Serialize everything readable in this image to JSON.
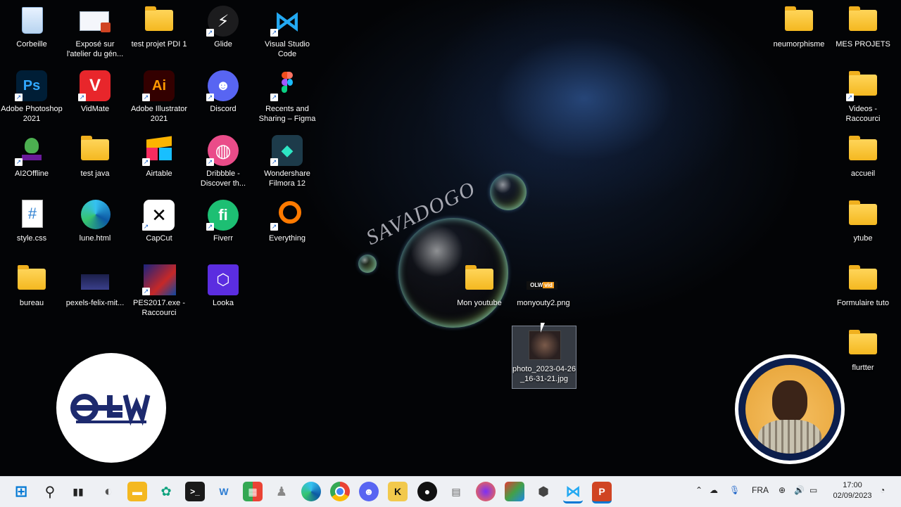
{
  "desktop_icons": [
    {
      "label": "Corbeille",
      "icon": "recycle-bin-icon"
    },
    {
      "label": "Exposé sur l'atelier du gén...",
      "icon": "powerpoint-file-icon"
    },
    {
      "label": "test projet PDI 1",
      "icon": "folder-icon"
    },
    {
      "label": "Glide",
      "icon": "glide-icon"
    },
    {
      "label": "Visual Studio Code",
      "icon": "vscode-icon"
    },
    {
      "label": "Adobe Photoshop 2021",
      "icon": "photoshop-icon"
    },
    {
      "label": "VidMate",
      "icon": "vidmate-icon"
    },
    {
      "label": "Adobe Illustrator 2021",
      "icon": "illustrator-icon"
    },
    {
      "label": "Discord",
      "icon": "discord-icon"
    },
    {
      "label": "Recents and Sharing – Figma",
      "icon": "figma-icon"
    },
    {
      "label": "AI2Offline",
      "icon": "ai2offline-icon"
    },
    {
      "label": "test java",
      "icon": "folder-icon"
    },
    {
      "label": "Airtable",
      "icon": "airtable-icon"
    },
    {
      "label": "Dribbble - Discover th...",
      "icon": "dribbble-icon"
    },
    {
      "label": "Wondershare Filmora 12",
      "icon": "filmora-icon"
    },
    {
      "label": "style.css",
      "icon": "css-file-icon"
    },
    {
      "label": "lune.html",
      "icon": "edge-html-icon"
    },
    {
      "label": "CapCut",
      "icon": "capcut-icon"
    },
    {
      "label": "Fiverr",
      "icon": "fiverr-icon"
    },
    {
      "label": "Everything",
      "icon": "everything-icon"
    },
    {
      "label": "bureau",
      "icon": "folder-icon"
    },
    {
      "label": "pexels-felix-mit...",
      "icon": "image-file-icon"
    },
    {
      "label": "PES2017.exe - Raccourci",
      "icon": "pes2017-icon"
    },
    {
      "label": "Looka",
      "icon": "looka-icon"
    },
    {
      "label": "Mon youtube",
      "icon": "folder-icon"
    },
    {
      "label": "monyouty2.png",
      "icon": "image-file-icon"
    },
    {
      "label": "photo_2023-04-26_16-31-21.jpg",
      "icon": "image-file-icon"
    },
    {
      "label": "neumorphisme",
      "icon": "folder-icon"
    },
    {
      "label": "MES PROJETS",
      "icon": "folder-icon"
    },
    {
      "label": "Videos - Raccourci",
      "icon": "folder-icon"
    },
    {
      "label": "accueil",
      "icon": "folder-icon"
    },
    {
      "label": "ytube",
      "icon": "folder-icon"
    },
    {
      "label": "Formulaire tuto",
      "icon": "folder-icon"
    },
    {
      "label": "flurtter",
      "icon": "folder-icon"
    }
  ],
  "glyphs": {
    "ps": "Ps",
    "vm": "V",
    "ai": "Ai",
    "hash": "#",
    "k": "K",
    "olw": "OLW",
    "vid": "vid"
  },
  "watermark": "SAVADOGO",
  "taskbar": {
    "language": "FRA",
    "time": "17:00",
    "date": "02/09/2023"
  },
  "colors": {
    "folder": "#f4b820",
    "taskbar_bg": "#eef0f4",
    "accent": "#0078d4"
  }
}
